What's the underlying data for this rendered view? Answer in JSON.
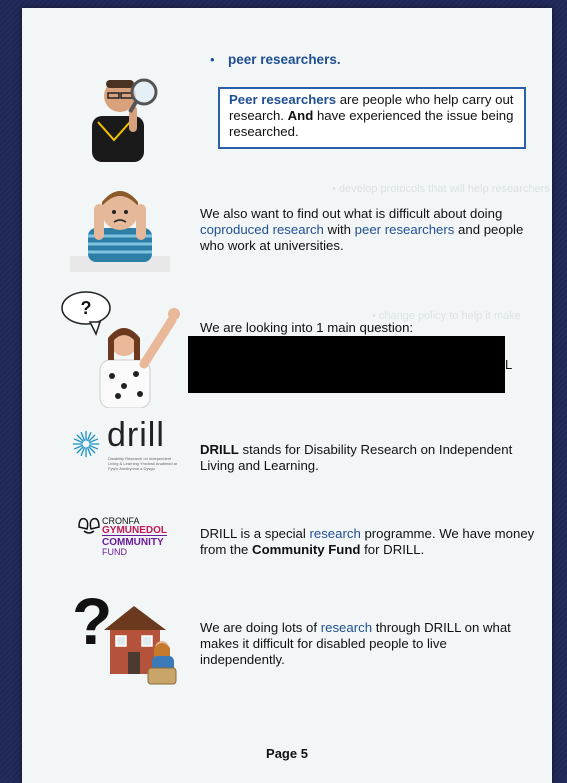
{
  "page": {
    "bullet": "peer researchers.",
    "definition": {
      "term": "Peer researchers",
      "mid": " are people who help carry out research. ",
      "bold": "And",
      "rest": " have experienced the issue being researched."
    },
    "section1": {
      "pre": "We also want to find out what is difficult about doing ",
      "link1": "coproduced research",
      "mid": " with ",
      "link2": "peer researchers",
      "post": " and people who work at universities."
    },
    "section2": {
      "text": "We are looking into 1 main question:",
      "tail": "L",
      "speech_bubble": "?"
    },
    "section3": {
      "bold": "DRILL",
      "text": " stands for Disability Research on Independent Living and Learning.",
      "logo_word": "drill",
      "logo_sub": "Disability Research on Independent Living & Learning Ymchwil Anabledd ar Fyw'n Annibynnol a Dysgu"
    },
    "section4": {
      "pre": "DRILL is a special ",
      "link": "research",
      "mid": " programme. We have money from the ",
      "bold": "Community Fund",
      "post": " for DRILL.",
      "logo_lines": [
        "CRONFA",
        "GYMUNEDOL",
        "COMMUNITY",
        "FUND"
      ]
    },
    "section5": {
      "pre": "We are doing lots of ",
      "link": "research",
      "post": " through DRILL on what makes it difficult for disabled people to live independently."
    },
    "footer": "Page 5"
  },
  "colors": {
    "accent": "#1f4f92",
    "box_border": "#2b5fa8",
    "background": "#202858",
    "page": "#f3f6f7",
    "cronfa_pink": "#c2185b",
    "cronfa_purple": "#6a1b9a"
  },
  "icons": [
    "magnifying-glass-icon",
    "worried-person-icon",
    "question-bubble-icon",
    "drill-sunburst-icon",
    "community-fund-hands-icon",
    "house-question-icon"
  ]
}
